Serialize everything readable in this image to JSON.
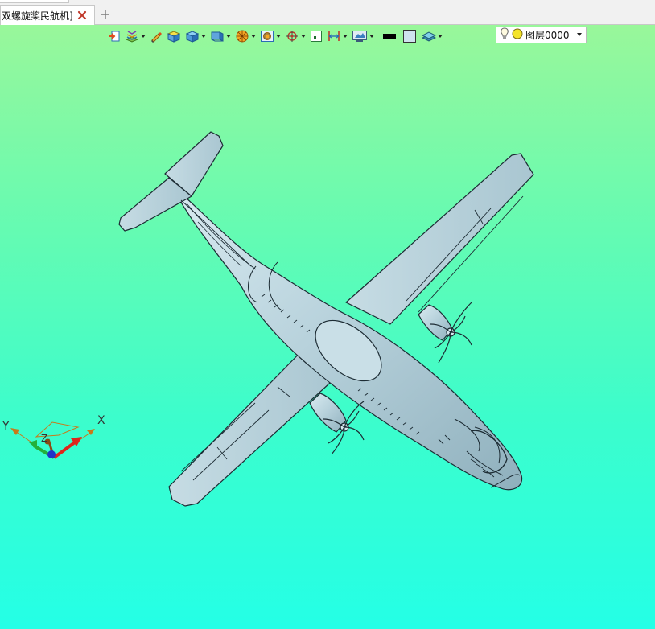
{
  "tab": {
    "title": "双螺旋桨民航机]",
    "close_icon": "close-icon",
    "add_icon": "plus-icon"
  },
  "toolbar": {
    "buttons": [
      {
        "name": "import-icon",
        "has_dropdown": false
      },
      {
        "name": "render-style-icon",
        "has_dropdown": true
      },
      {
        "name": "pencil-icon",
        "has_dropdown": false
      },
      {
        "name": "solid-box-icon",
        "has_dropdown": false
      },
      {
        "name": "box-view-icon",
        "has_dropdown": true
      },
      {
        "name": "view-orientation-icon",
        "has_dropdown": true
      },
      {
        "name": "sphere-display-icon",
        "has_dropdown": true
      },
      {
        "name": "zoom-fit-icon",
        "has_dropdown": true
      },
      {
        "name": "snap-target-icon",
        "has_dropdown": true
      },
      {
        "name": "point-icon",
        "has_dropdown": false
      },
      {
        "name": "dimension-icon",
        "has_dropdown": true
      },
      {
        "name": "screen-capture-icon",
        "has_dropdown": true
      },
      {
        "name": "line-color-icon",
        "has_dropdown": false
      },
      {
        "name": "fill-color-icon",
        "has_dropdown": false
      },
      {
        "name": "layers-icon",
        "has_dropdown": true
      }
    ]
  },
  "layer": {
    "value": "图层0000",
    "bulb_icon": "lightbulb-icon",
    "status_icon": "yellow-dot-icon"
  },
  "triad": {
    "x_label": "X",
    "y_label": "Y",
    "z_label": "Z"
  },
  "colors": {
    "viewport_top": "#99f79a",
    "viewport_bottom": "#24ffe6",
    "model_fill": "#b9d3dc",
    "model_edge": "#1c2b33",
    "axis_x": "#e0251c",
    "axis_y": "#23b03a",
    "axis_z": "#1f34c9"
  }
}
